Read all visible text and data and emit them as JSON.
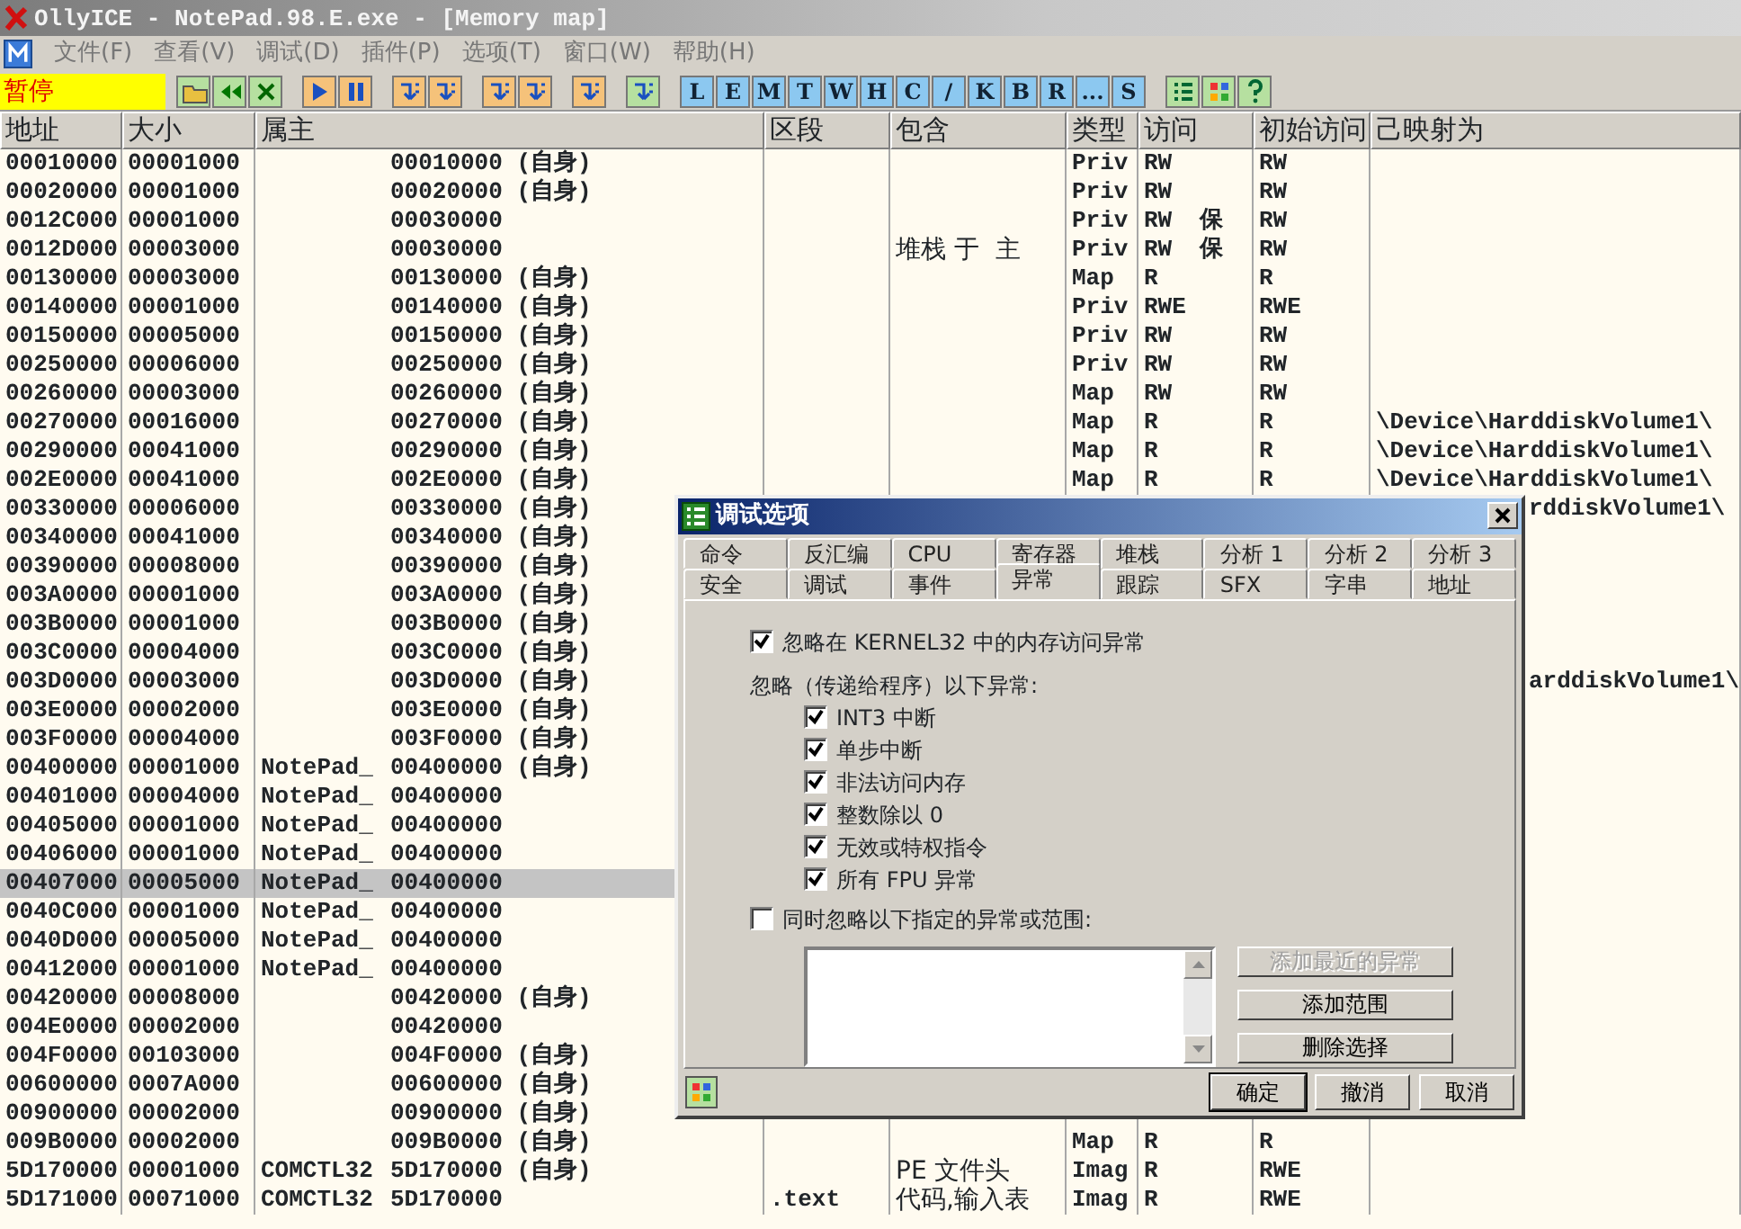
{
  "window": {
    "title": "OllyICE - NotePad.98.E.exe - [Memory map]"
  },
  "menu": [
    "文件(F)",
    "查看(V)",
    "调试(D)",
    "插件(P)",
    "选项(T)",
    "窗口(W)",
    "帮助(H)"
  ],
  "status": "暂停",
  "letter_buttons": [
    "L",
    "E",
    "M",
    "T",
    "W",
    "H",
    "C",
    "/",
    "K",
    "B",
    "R",
    "...",
    "S"
  ],
  "table": {
    "columns": [
      "地址",
      "大小",
      "属主",
      "区段",
      "包含",
      "类型",
      "访问",
      "初始访问",
      "己映射为"
    ],
    "rows": [
      {
        "address": "00010000",
        "size": "00001000",
        "owner_base": "00010000 (自身)",
        "type": "Priv",
        "access": "RW",
        "initial_access": "RW",
        "selected": false
      },
      {
        "address": "00020000",
        "size": "00001000",
        "owner_base": "00020000 (自身)",
        "type": "Priv",
        "access": "RW",
        "initial_access": "RW",
        "selected": false
      },
      {
        "address": "0012C000",
        "size": "00001000",
        "owner_base": "00030000",
        "type": "Priv",
        "access": "RW  保",
        "initial_access": "RW",
        "selected": false
      },
      {
        "address": "0012D000",
        "size": "00003000",
        "owner_base": "00030000",
        "contains": "堆栈 于  主",
        "type": "Priv",
        "access": "RW  保",
        "initial_access": "RW",
        "selected": false
      },
      {
        "address": "00130000",
        "size": "00003000",
        "owner_base": "00130000 (自身)",
        "type": "Map",
        "access": "R",
        "initial_access": "R",
        "selected": false
      },
      {
        "address": "00140000",
        "size": "00001000",
        "owner_base": "00140000 (自身)",
        "type": "Priv",
        "access": "RWE",
        "initial_access": "RWE",
        "selected": false
      },
      {
        "address": "00150000",
        "size": "00005000",
        "owner_base": "00150000 (自身)",
        "type": "Priv",
        "access": "RW",
        "initial_access": "RW",
        "selected": false
      },
      {
        "address": "00250000",
        "size": "00006000",
        "owner_base": "00250000 (自身)",
        "type": "Priv",
        "access": "RW",
        "initial_access": "RW",
        "selected": false
      },
      {
        "address": "00260000",
        "size": "00003000",
        "owner_base": "00260000 (自身)",
        "type": "Map",
        "access": "RW",
        "initial_access": "RW",
        "selected": false
      },
      {
        "address": "00270000",
        "size": "00016000",
        "owner_base": "00270000 (自身)",
        "type": "Map",
        "access": "R",
        "initial_access": "R",
        "mapped_as": "\\Device\\HarddiskVolume1\\",
        "selected": false
      },
      {
        "address": "00290000",
        "size": "00041000",
        "owner_base": "00290000 (自身)",
        "type": "Map",
        "access": "R",
        "initial_access": "R",
        "mapped_as": "\\Device\\HarddiskVolume1\\",
        "selected": false
      },
      {
        "address": "002E0000",
        "size": "00041000",
        "owner_base": "002E0000 (自身)",
        "type": "Map",
        "access": "R",
        "initial_access": "R",
        "mapped_as": "\\Device\\HarddiskVolume1\\",
        "selected": false
      },
      {
        "address": "00330000",
        "size": "00006000",
        "owner_base": "00330000 (自身)",
        "mapped_as_visible": "rddiskVolume1\\",
        "selected": false
      },
      {
        "address": "00340000",
        "size": "00041000",
        "owner_base": "00340000 (自身)",
        "selected": false
      },
      {
        "address": "00390000",
        "size": "00008000",
        "owner_base": "00390000 (自身)",
        "selected": false
      },
      {
        "address": "003A0000",
        "size": "00001000",
        "owner_base": "003A0000 (自身)",
        "selected": false
      },
      {
        "address": "003B0000",
        "size": "00001000",
        "owner_base": "003B0000 (自身)",
        "selected": false
      },
      {
        "address": "003C0000",
        "size": "00004000",
        "owner_base": "003C0000 (自身)",
        "selected": false
      },
      {
        "address": "003D0000",
        "size": "00003000",
        "owner_base": "003D0000 (自身)",
        "mapped_as_visible": "arddiskVolume1\\",
        "selected": false
      },
      {
        "address": "003E0000",
        "size": "00002000",
        "owner_base": "003E0000 (自身)",
        "selected": false
      },
      {
        "address": "003F0000",
        "size": "00004000",
        "owner_base": "003F0000 (自身)",
        "selected": false
      },
      {
        "address": "00400000",
        "size": "00001000",
        "owner_module": "NotePad_",
        "owner_base": "00400000 (自身)",
        "selected": false
      },
      {
        "address": "00401000",
        "size": "00004000",
        "owner_module": "NotePad_",
        "owner_base": "00400000",
        "selected": false
      },
      {
        "address": "00405000",
        "size": "00001000",
        "owner_module": "NotePad_",
        "owner_base": "00400000",
        "selected": false
      },
      {
        "address": "00406000",
        "size": "00001000",
        "owner_module": "NotePad_",
        "owner_base": "00400000",
        "selected": false
      },
      {
        "address": "00407000",
        "size": "00005000",
        "owner_module": "NotePad_",
        "owner_base": "00400000",
        "selected": true
      },
      {
        "address": "0040C000",
        "size": "00001000",
        "owner_module": "NotePad_",
        "owner_base": "00400000",
        "selected": false
      },
      {
        "address": "0040D000",
        "size": "00005000",
        "owner_module": "NotePad_",
        "owner_base": "00400000",
        "selected": false
      },
      {
        "address": "00412000",
        "size": "00001000",
        "owner_module": "NotePad_",
        "owner_base": "00400000",
        "selected": false
      },
      {
        "address": "00420000",
        "size": "00008000",
        "owner_base": "00420000 (自身)",
        "selected": false
      },
      {
        "address": "004E0000",
        "size": "00002000",
        "owner_base": "00420000",
        "selected": false
      },
      {
        "address": "004F0000",
        "size": "00103000",
        "owner_base": "004F0000 (自身)",
        "selected": false
      },
      {
        "address": "00600000",
        "size": "0007A000",
        "owner_base": "00600000 (自身)",
        "selected": false
      },
      {
        "address": "00900000",
        "size": "00002000",
        "owner_base": "00900000 (自身)",
        "selected": false
      },
      {
        "address": "009B0000",
        "size": "00002000",
        "owner_base": "009B0000 (自身)",
        "type": "Map",
        "access": "R",
        "initial_access": "R",
        "selected": false
      },
      {
        "address": "5D170000",
        "size": "00001000",
        "owner_module": "COMCTL32",
        "owner_base": "5D170000 (自身)",
        "contains": "PE 文件头",
        "type": "Imag",
        "access": "R",
        "initial_access": "RWE",
        "selected": false
      },
      {
        "address": "5D171000",
        "size": "00071000",
        "owner_module": "COMCTL32",
        "owner_base": "5D170000",
        "section": ".text",
        "contains": "代码,输入表",
        "type": "Imag",
        "access": "R",
        "initial_access": "RWE",
        "selected": false
      }
    ]
  },
  "dialog": {
    "title": "调试选项",
    "tab_rows": [
      [
        {
          "label": "命令",
          "selected": false
        },
        {
          "label": "反汇编",
          "selected": false
        },
        {
          "label": "CPU",
          "selected": false
        },
        {
          "label": "寄存器",
          "selected": false
        },
        {
          "label": "堆栈",
          "selected": false
        },
        {
          "label": "分析 1",
          "selected": false
        },
        {
          "label": "分析 2",
          "selected": false
        },
        {
          "label": "分析 3",
          "selected": false
        }
      ],
      [
        {
          "label": "安全",
          "selected": false
        },
        {
          "label": "调试",
          "selected": false
        },
        {
          "label": "事件",
          "selected": false
        },
        {
          "label": "异常",
          "selected": true
        },
        {
          "label": "跟踪",
          "selected": false
        },
        {
          "label": "SFX",
          "selected": false
        },
        {
          "label": "字串",
          "selected": false
        },
        {
          "label": "地址",
          "selected": false
        }
      ]
    ],
    "ignore_kernel32": {
      "label": "忽略在 KERNEL32 中的内存访问异常",
      "checked": true
    },
    "group_label": "忽略（传递给程序）以下异常:",
    "exceptions": [
      {
        "label": "INT3 中断",
        "checked": true
      },
      {
        "label": "单步中断",
        "checked": true
      },
      {
        "label": "非法访问内存",
        "checked": true
      },
      {
        "label": "整数除以 0",
        "checked": true
      },
      {
        "label": "无效或特权指令",
        "checked": true
      },
      {
        "label": "所有 FPU 异常",
        "checked": true
      }
    ],
    "ignore_ranges": {
      "label": "同时忽略以下指定的异常或范围:",
      "checked": false
    },
    "range_buttons": [
      {
        "label": "添加最近的异常",
        "disabled": true
      },
      {
        "label": "添加范围",
        "disabled": false
      },
      {
        "label": "删除选择",
        "disabled": false
      }
    ],
    "buttons": [
      {
        "label": "确定",
        "default": true
      },
      {
        "label": "撤消",
        "default": false
      },
      {
        "label": "取消",
        "default": false
      }
    ]
  }
}
